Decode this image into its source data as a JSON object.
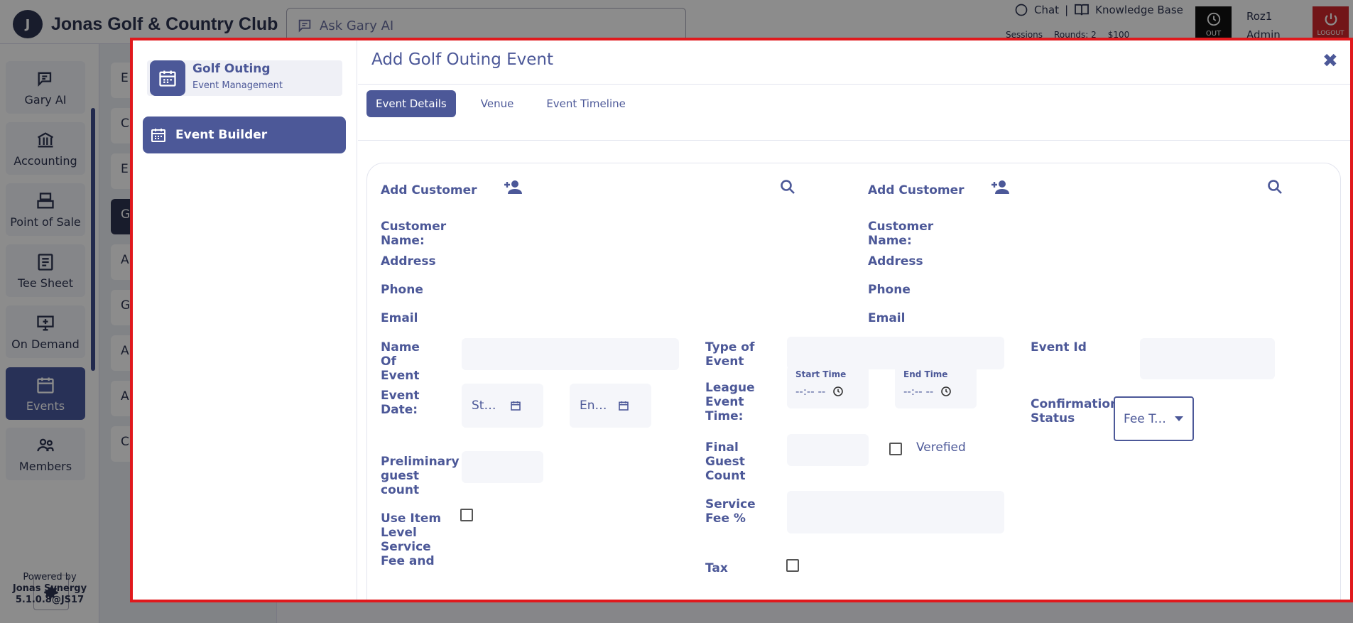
{
  "app": {
    "logo_mark": "J",
    "club_name": "Jonas Golf & Country Club",
    "search_placeholder": "Ask Gary AI",
    "top_links": {
      "chat": "Chat",
      "separator": "|",
      "knowledge_base": "Knowledge Base"
    },
    "top_sub": {
      "sessions": "Sessions",
      "rounds": "Rounds: 2",
      "amount": "$100"
    },
    "out_label": "OUT",
    "user": {
      "name": "Roz1",
      "role": "Admin"
    },
    "logout_label": "LOGOUT",
    "nav": [
      {
        "label": "Gary AI",
        "icon": "gary-ai-icon"
      },
      {
        "label": "Accounting",
        "icon": "bank-icon"
      },
      {
        "label": "Point of Sale",
        "icon": "register-icon"
      },
      {
        "label": "Tee Sheet",
        "icon": "document-icon"
      },
      {
        "label": "On Demand",
        "icon": "monitor-icon"
      },
      {
        "label": "Events",
        "icon": "calendar-icon",
        "active": true
      },
      {
        "label": "Members",
        "icon": "members-icon"
      }
    ],
    "powered_by": {
      "line1": "Powered by",
      "line2": "Jonas Synergy",
      "line3": "5.1.0.8@JS17"
    },
    "submenu": [
      "E",
      "C",
      "E",
      "G",
      "A N",
      "G",
      "A N",
      "A",
      "C"
    ]
  },
  "modal": {
    "module_title": "Golf Outing",
    "module_subtitle": "Event Management",
    "builder_label": "Event Builder",
    "title": "Add Golf Outing Event",
    "close_label": "✖",
    "tabs": [
      "Event Details",
      "Venue",
      "Event Timeline"
    ],
    "customer_left": {
      "add_label": "Add Customer",
      "name_label": "Customer Name:",
      "address_label": "Address",
      "phone_label": "Phone",
      "email_label": "Email"
    },
    "customer_right": {
      "add_label": "Add Customer",
      "name_label": "Customer Name:",
      "address_label": "Address",
      "phone_label": "Phone",
      "email_label": "Email"
    },
    "form": {
      "name_of_event": "Name Of Event",
      "type_of_event": "Type of Event",
      "event_id": "Event Id",
      "event_date": "Event Date:",
      "start_date_placeholder": "Start Date",
      "end_date_placeholder": "End Date",
      "league_event_time": "League Event Time:",
      "start_time_caption": "Start Time",
      "end_time_caption": "End Time",
      "time_placeholder": "--:-- --",
      "confirmation_status": "Confirmation Status",
      "fee_type_value": "Fee Type",
      "final_guest_count": "Final Guest Count",
      "verified_label": "Verefied",
      "preliminary_guest_count": "Preliminary guest count",
      "service_fee_pct": "Service Fee %",
      "use_item_level": "Use Item Level Service Fee and",
      "tax_label": "Tax"
    }
  }
}
